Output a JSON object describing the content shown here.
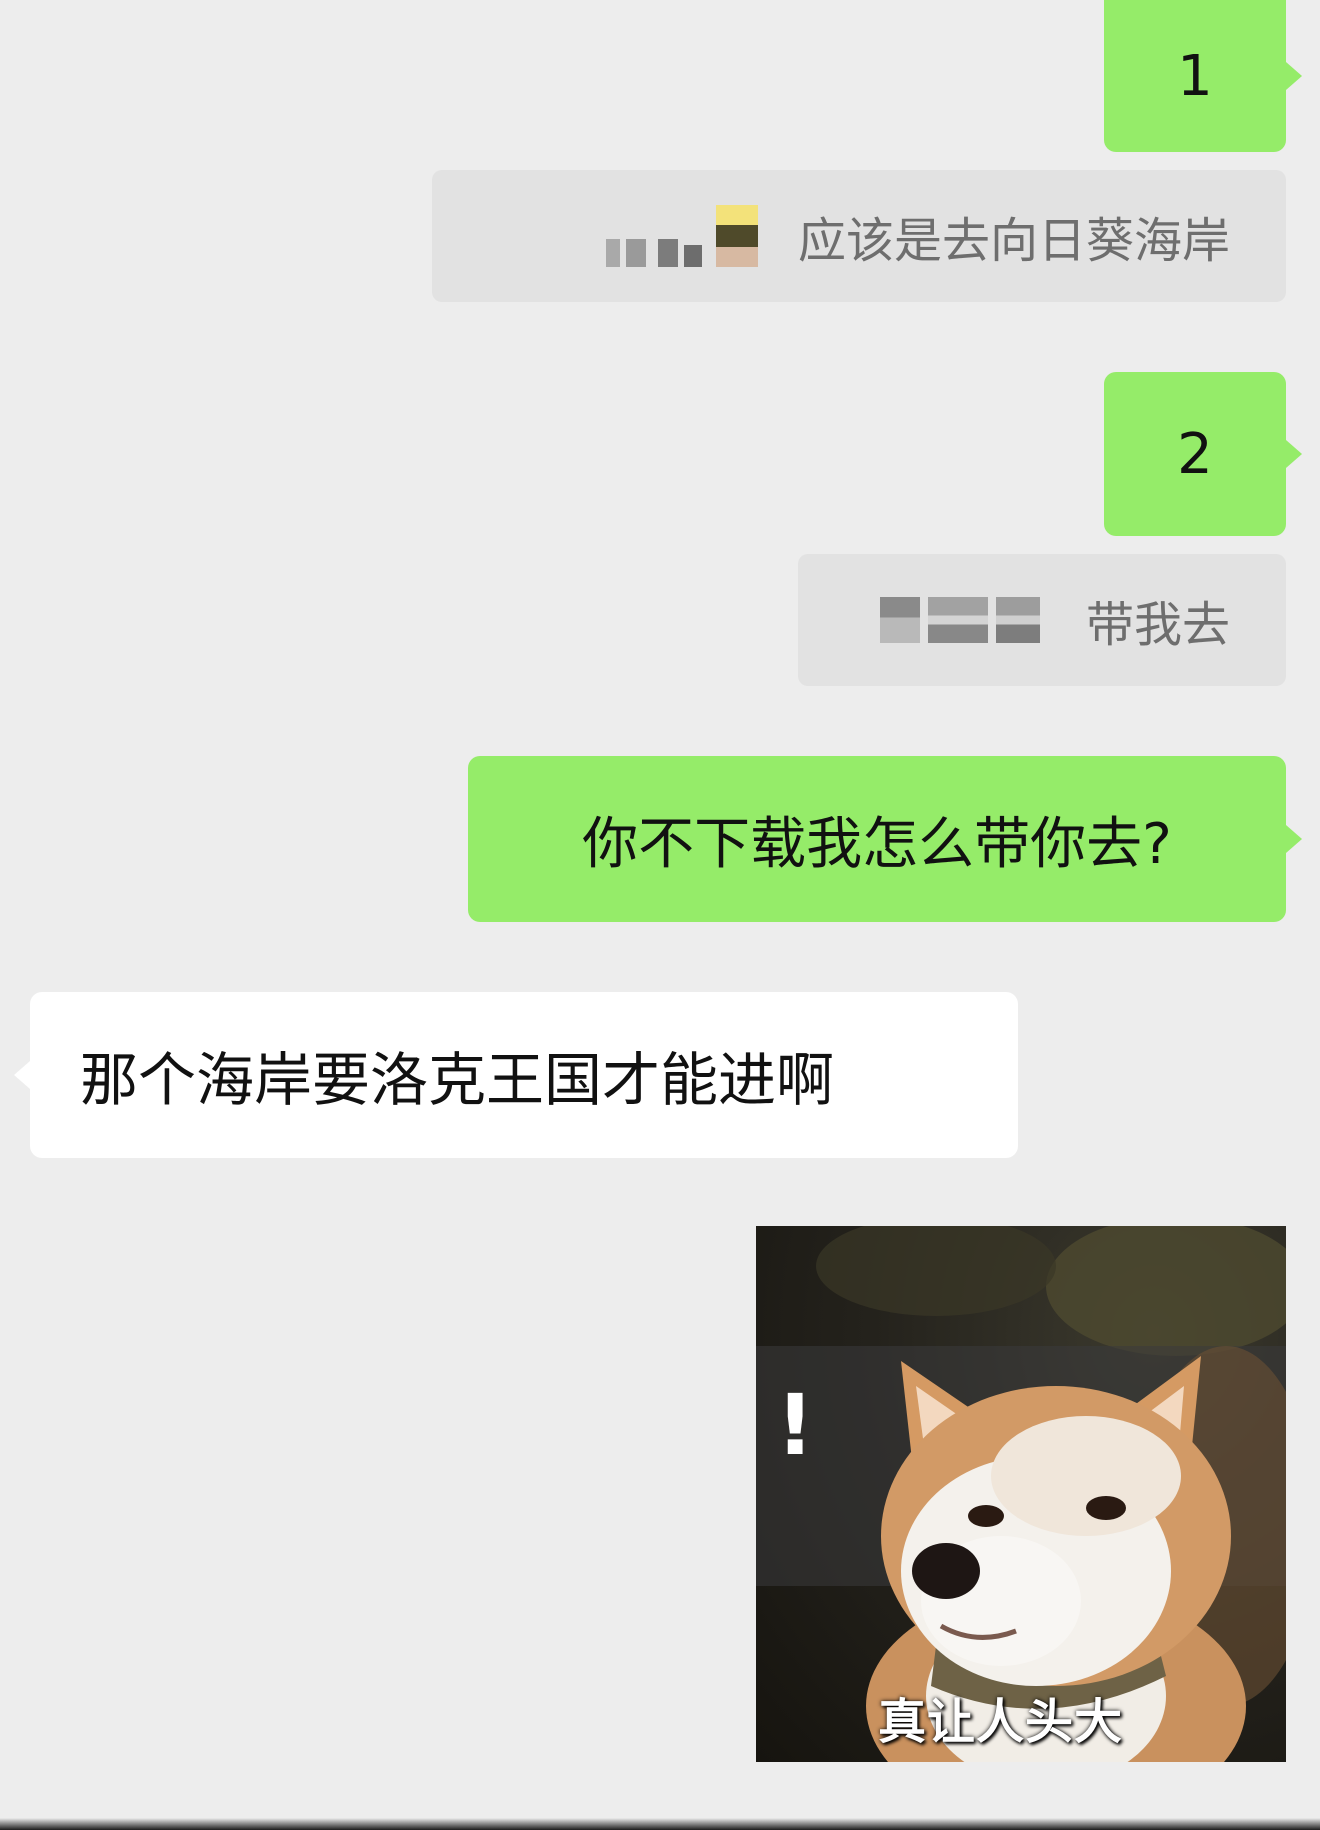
{
  "messages": {
    "msg1": "1",
    "quote1": "应该是去向日葵海岸",
    "msg2": "2",
    "quote2": "带我去",
    "msg3": "你不下载我怎么带你去?",
    "msg4": "那个海岸要洛克王国才能进啊",
    "sticker_caption": "真让人头大",
    "sticker_mark": "!"
  },
  "colors": {
    "background": "#ededed",
    "outgoing_bubble": "#95ec69",
    "incoming_bubble": "#ffffff",
    "quote_block": "#e2e2e2",
    "quote_text": "#6e6e6e"
  }
}
